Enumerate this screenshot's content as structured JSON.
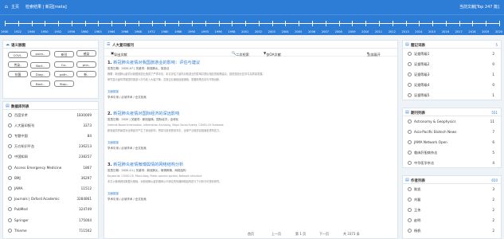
{
  "topbar": {
    "home": "主页",
    "crumb": "检索结果 | 新冠[meta]",
    "stat": "当前文献[Top 247 篇]"
  },
  "timeline": {
    "years": [
      "1900",
      "1922",
      "1946",
      "1950",
      "1952",
      "1956",
      "1960",
      "1963",
      "1964",
      "1966",
      "1968",
      "1972",
      "1980",
      "1986",
      "1990",
      "1993",
      "1996",
      "1998",
      "2001",
      "2002",
      "2003",
      "2004",
      "2005",
      "2006",
      "2007",
      "2008",
      "2009",
      "2010",
      "2011",
      "2012",
      "2013",
      "2014",
      "2015",
      "2016",
      "2017",
      "2018",
      "2019",
      "2020"
    ]
  },
  "cloud": {
    "title": "语义脉图",
    "items": [
      "COVI..",
      "pulm..",
      "新冠",
      "感染",
      "传染..",
      "Nort..",
      "Co..",
      "pnn..",
      "抗菌",
      "Diag..",
      "path..",
      "新..",
      "Bact..",
      "Stap.."
    ]
  },
  "sources": {
    "title": "数据库列表",
    "rows": [
      {
        "name": "百度学术",
        "count": "1830009"
      },
      {
        "name": "人大复印报刊",
        "count": "3373"
      },
      {
        "name": "专题中国",
        "count": "84"
      },
      {
        "name": "万方知识平台",
        "count": "236213"
      },
      {
        "name": "中国知网",
        "count": "238257"
      },
      {
        "name": "Access Emergency Medicine",
        "count": "1867"
      },
      {
        "name": "BMJ",
        "count": "36297"
      },
      {
        "name": "JAMA",
        "count": "11512"
      },
      {
        "name": "Journals | Oxford Academic",
        "count": "3284861"
      },
      {
        "name": "PubMed",
        "count": "324749"
      },
      {
        "name": "Springer",
        "count": "175004"
      },
      {
        "name": "Thieme",
        "count": "711502"
      }
    ]
  },
  "center": {
    "title": "人大复印报刊",
    "export": "导出文献",
    "sort": "二次检索",
    "filter": "仅OA文献",
    "batch": "全部展开",
    "articles": [
      {
        "num": "1.",
        "title": "新冠肺炎疫情对我国旅游业的影响：评估与建议",
        "meta": "发表日期：2020-07 | 关键词：新冠肺炎，旅游业",
        "abs1": "摘要：新冠肺炎疫情对我国旅游业造成了严重冲击，本文评估了疫情对旅游业的影响并提出相应的政策建议，促进旅游业复苏与高质量发展。",
        "abs2": "研究显示疫情导致国内旅游人次与收入大幅下降，文旅企业面临经营困难，需要政策支持与市场创新。",
        "src": "文献链接",
        "links": "学术引用 / 必读学术 / 全文检索"
      },
      {
        "num": "2.",
        "title": "新冠肺炎疫情对国际经济的深远影响",
        "meta": "发表日期：2020 | 关键词：新冠疫情，国际经济，全球化",
        "abs1": "Internet-Based Information, Information Archiving, Major Social Events, COVID-19 Outbreak",
        "abs2": "新冠疫情的暴发对全球经济产生了深远影响，贸易与投资受到冲击，全球产业链供应链面临重构压力。",
        "src": "文献链接",
        "links": "学术引用 / 必读学术 / 全文检索"
      },
      {
        "num": "3.",
        "title": "新冠肺炎疫情微博舆情的网络结构分析",
        "meta": "发表日期：2020-11 | 关键词：新冠肺炎，微博舆情，网络结构",
        "abs1": "Keywords: COVID-19, Micro-blog, Public opinion spread, Network structure",
        "abs2": "本文以微博舆情数据为基础，对新冠肺炎疫情期间公众舆论的传播网络结构进行了分析与可视化研究。",
        "src": "文献链接",
        "links": "学术引用 / 必读学术 / 全文检索"
      }
    ],
    "pager": {
      "first": "首页",
      "prev": "上一页",
      "page": "第 1 页",
      "next": "下一页",
      "total": "共 3373 条"
    }
  },
  "rightTop": {
    "title": "题记词表",
    "count": "5",
    "rows": [
      {
        "name": "证据等级1",
        "count": "2"
      },
      {
        "name": "证据等级2",
        "count": "0"
      },
      {
        "name": "证据等级3",
        "count": "1"
      },
      {
        "name": "证据等级4",
        "count": "0"
      },
      {
        "name": "证据等级5",
        "count": "1"
      }
    ]
  },
  "rightMid": {
    "title": "期刊列表",
    "count": "551",
    "rows": [
      {
        "name": "Astronomy & Geophysics",
        "count": "11"
      },
      {
        "name": "Asia-Pacific Biotech News",
        "count": "7"
      },
      {
        "name": "JAMA Network Open",
        "count": "6"
      },
      {
        "name": "临床肝胆病杂志",
        "count": "5"
      },
      {
        "name": "中华医学杂志",
        "count": "4"
      }
    ]
  },
  "rightBot": {
    "title": "作者列表",
    "count": "650",
    "rows": [
      {
        "name": "陈凯",
        "count": "3"
      },
      {
        "name": "刘磊",
        "count": "2"
      },
      {
        "name": "王伟",
        "count": "2"
      },
      {
        "name": "赵明",
        "count": "2"
      },
      {
        "name": "杨帆",
        "count": "2"
      }
    ]
  }
}
